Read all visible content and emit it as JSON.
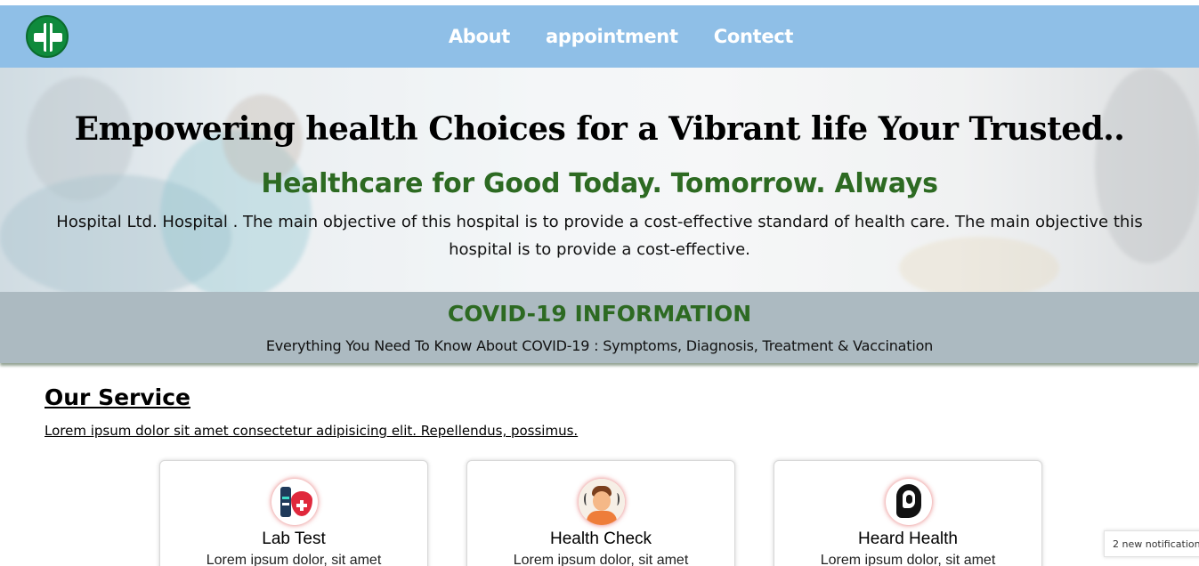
{
  "navbar": {
    "logo_icon": "medical-cross-staff-icon",
    "links": [
      "About",
      "appointment",
      "Contect"
    ]
  },
  "hero": {
    "title": "Empowering health Choices for a Vibrant life Your Trusted..",
    "subtitle": "Healthcare for Good Today. Tomorrow. Always",
    "body": "Hospital Ltd. Hospital . The main objective of this hospital is to provide a cost-effective standard of health care. The main objective this hospital is to provide a cost-effective."
  },
  "covid": {
    "title": "COVID-19 INFORMATION",
    "subtitle": "Everything You Need To Know About COVID-19 : Symptoms, Diagnosis, Treatment & Vaccination"
  },
  "services": {
    "heading": "Our Service",
    "description": "Lorem ipsum dolor sit amet consectetur adipisicing elit. Repellendus, possimus.",
    "cards": [
      {
        "title": "Lab Test",
        "text": "Lorem ipsum dolor, sit amet",
        "icon": "lab-test-icon"
      },
      {
        "title": "Health Check",
        "text": "Lorem ipsum dolor, sit amet",
        "icon": "health-check-icon"
      },
      {
        "title": "Heard Health",
        "text": "Lorem ipsum dolor, sit amet",
        "icon": "ear-icon"
      }
    ]
  },
  "notification": {
    "text": "2 new notification"
  },
  "colors": {
    "navbar": "#8fbfe7",
    "accent_green": "#2d6a22",
    "covid_band": "#acbac1"
  }
}
